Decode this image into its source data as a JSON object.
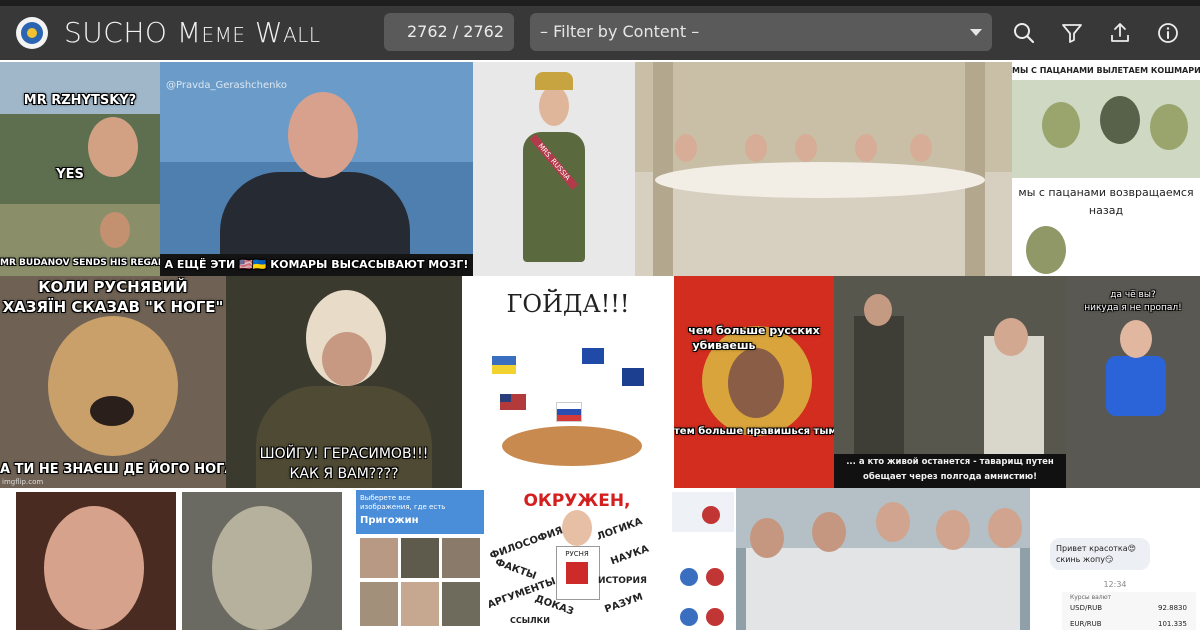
{
  "header": {
    "title": "SUCHO Meme Wall",
    "counter": "2762 / 2762",
    "filter_placeholder": "– Filter by Content –",
    "icons": [
      "search-icon",
      "filter-icon",
      "upload-icon",
      "info-icon"
    ]
  },
  "colors": {
    "header_bg": "#383838",
    "control_bg": "#5a5a5a",
    "text": "#f1f1f1"
  },
  "memes": {
    "m1": {
      "top": "MR RZHYTSKY?",
      "mid": "YES",
      "bottom": "MR BUDANOV SENDS HIS REGARDS"
    },
    "m2": {
      "watermark": "@Pravda_Gerashchenko",
      "caption": "А ЕЩЁ ЭТИ 🇺🇸🇺🇦 КОМАРЫ ВЫСАСЫВАЮТ МОЗГ!"
    },
    "m3": {
      "sash": "MRS. RUSSIA"
    },
    "m5": {
      "top": "МЫ С ПАЦАНАМИ ВЫЛЕТАЕМ КОШМАРИТЬ УКРОВ",
      "bottom_line1": "мы с пацанами возвращаемся",
      "bottom_line2": "назад"
    },
    "m6": {
      "top_line1": "КОЛИ РУСНЯВИЙ",
      "top_line2": "ХАЗЯЇН СКАЗАВ \"К НОГЕ\"",
      "bottom": "А ТИ НЕ ЗНАЄШ ДЕ ЙОГО НОГА",
      "watermark": "imgflip.com"
    },
    "m7": {
      "line1": "ШОЙГУ! ГЕРАСИМОВ!!!",
      "line2": "КАК Я ВАМ????"
    },
    "m8": {
      "title": "ГОЙДА!!!"
    },
    "m9": {
      "top_line1": "чем больше русских",
      "top_line2": "убиваешь",
      "bottom": "тем больше нравишься тым"
    },
    "m10": {
      "line1": "... а кто живой останется - таварищ путен",
      "line2": "обещает через полгода амнистию!"
    },
    "m11": {
      "line1": "да чё вы?",
      "line2": "никуда я не пропал!"
    },
    "m13": {
      "line1": "Выберете все",
      "line2": "изображения, где есть",
      "name": "Пригожин"
    },
    "m14": {
      "title": "ОКРУЖЕН,",
      "words": [
        "ЛОГИКА",
        "ФИЛОСОФИЯ",
        "ФАКТЫ",
        "НАУКА",
        "АРГУМЕНТЫ",
        "ИСТОРИЯ",
        "ДОКАЗ",
        "РАЗУМ",
        "ССЫЛКИ"
      ],
      "shirt": "РУСНЯ"
    },
    "m17": {
      "message": "Привет красотка😍 скинь жопу😏",
      "time": "12:34",
      "rates_title": "Курсы валют",
      "usd_label": "USD/RUB",
      "usd_value": "92.8830",
      "eur_label": "EUR/RUB",
      "eur_value": "101.335"
    }
  }
}
